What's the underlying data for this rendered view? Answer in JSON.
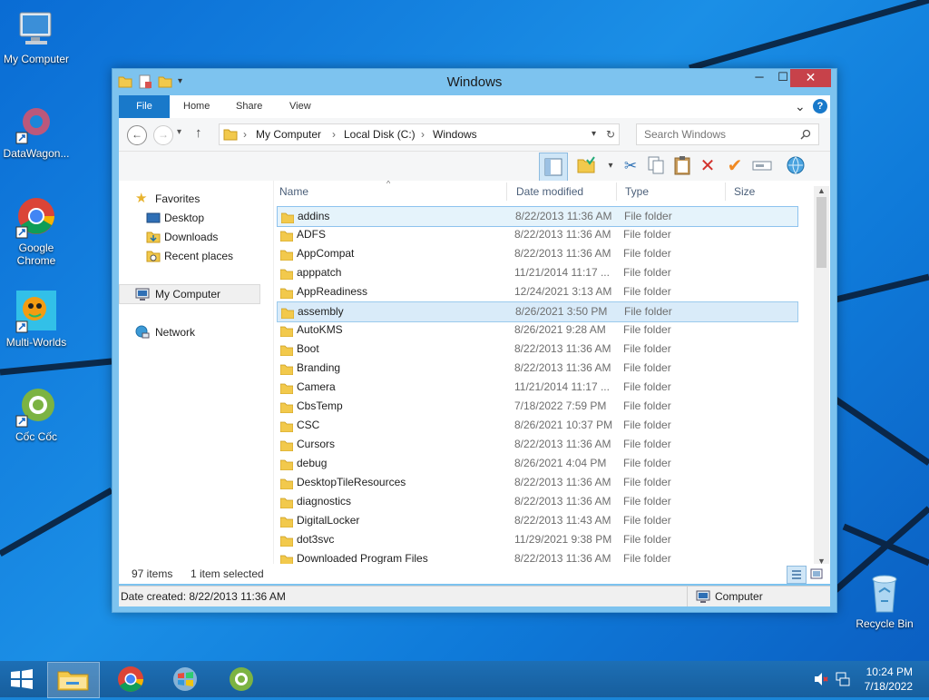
{
  "desktop": {
    "icons": [
      {
        "label": "My Computer"
      },
      {
        "label": "DataWagon..."
      },
      {
        "label": "Google Chrome"
      },
      {
        "label": "Multi-Worlds"
      },
      {
        "label": "Cốc Cốc"
      },
      {
        "label": "Recycle Bin"
      }
    ]
  },
  "window": {
    "title": "Windows",
    "minimize": "─",
    "maximize": "☐",
    "close": "✕"
  },
  "ribbon": {
    "tabs": [
      "File",
      "Home",
      "Share",
      "View"
    ],
    "expand": "⌄",
    "help": "?"
  },
  "address": {
    "crumbs": [
      "My Computer",
      "Local Disk (C:)",
      "Windows"
    ],
    "separator": "›",
    "refresh": "↻",
    "search_placeholder": "Search Windows"
  },
  "nav": {
    "back": "←",
    "forward": "→",
    "recent": "▾",
    "up": "↑"
  },
  "navpane": {
    "favorites": "Favorites",
    "desktop": "Desktop",
    "downloads": "Downloads",
    "recent": "Recent places",
    "computer": "My Computer",
    "network": "Network"
  },
  "columns": {
    "name": "Name",
    "date": "Date modified",
    "type": "Type",
    "size": "Size"
  },
  "files": [
    {
      "name": "addins",
      "date": "8/22/2013 11:36 AM",
      "type": "File folder"
    },
    {
      "name": "ADFS",
      "date": "8/22/2013 11:36 AM",
      "type": "File folder"
    },
    {
      "name": "AppCompat",
      "date": "8/22/2013 11:36 AM",
      "type": "File folder"
    },
    {
      "name": "apppatch",
      "date": "11/21/2014 11:17 ...",
      "type": "File folder"
    },
    {
      "name": "AppReadiness",
      "date": "12/24/2021 3:13 AM",
      "type": "File folder"
    },
    {
      "name": "assembly",
      "date": "8/26/2021 3:50 PM",
      "type": "File folder"
    },
    {
      "name": "AutoKMS",
      "date": "8/26/2021 9:28 AM",
      "type": "File folder"
    },
    {
      "name": "Boot",
      "date": "8/22/2013 11:36 AM",
      "type": "File folder"
    },
    {
      "name": "Branding",
      "date": "8/22/2013 11:36 AM",
      "type": "File folder"
    },
    {
      "name": "Camera",
      "date": "11/21/2014 11:17 ...",
      "type": "File folder"
    },
    {
      "name": "CbsTemp",
      "date": "7/18/2022 7:59 PM",
      "type": "File folder"
    },
    {
      "name": "CSC",
      "date": "8/26/2021 10:37 PM",
      "type": "File folder"
    },
    {
      "name": "Cursors",
      "date": "8/22/2013 11:36 AM",
      "type": "File folder"
    },
    {
      "name": "debug",
      "date": "8/26/2021 4:04 PM",
      "type": "File folder"
    },
    {
      "name": "DesktopTileResources",
      "date": "8/22/2013 11:36 AM",
      "type": "File folder"
    },
    {
      "name": "diagnostics",
      "date": "8/22/2013 11:36 AM",
      "type": "File folder"
    },
    {
      "name": "DigitalLocker",
      "date": "8/22/2013 11:43 AM",
      "type": "File folder"
    },
    {
      "name": "dot3svc",
      "date": "11/29/2021 9:38 PM",
      "type": "File folder"
    },
    {
      "name": "Downloaded Program Files",
      "date": "8/22/2013 11:36 AM",
      "type": "File folder"
    }
  ],
  "status": {
    "items": "97 items",
    "selected": "1 item selected"
  },
  "info": {
    "created": "Date created: 8/22/2013 11:36 AM",
    "location": "Computer"
  },
  "clock": {
    "time": "10:24 PM",
    "date": "7/18/2022"
  },
  "colors": {
    "accent": "#1979ca",
    "selection": "#d9ebf9",
    "close": "#c7424a"
  }
}
